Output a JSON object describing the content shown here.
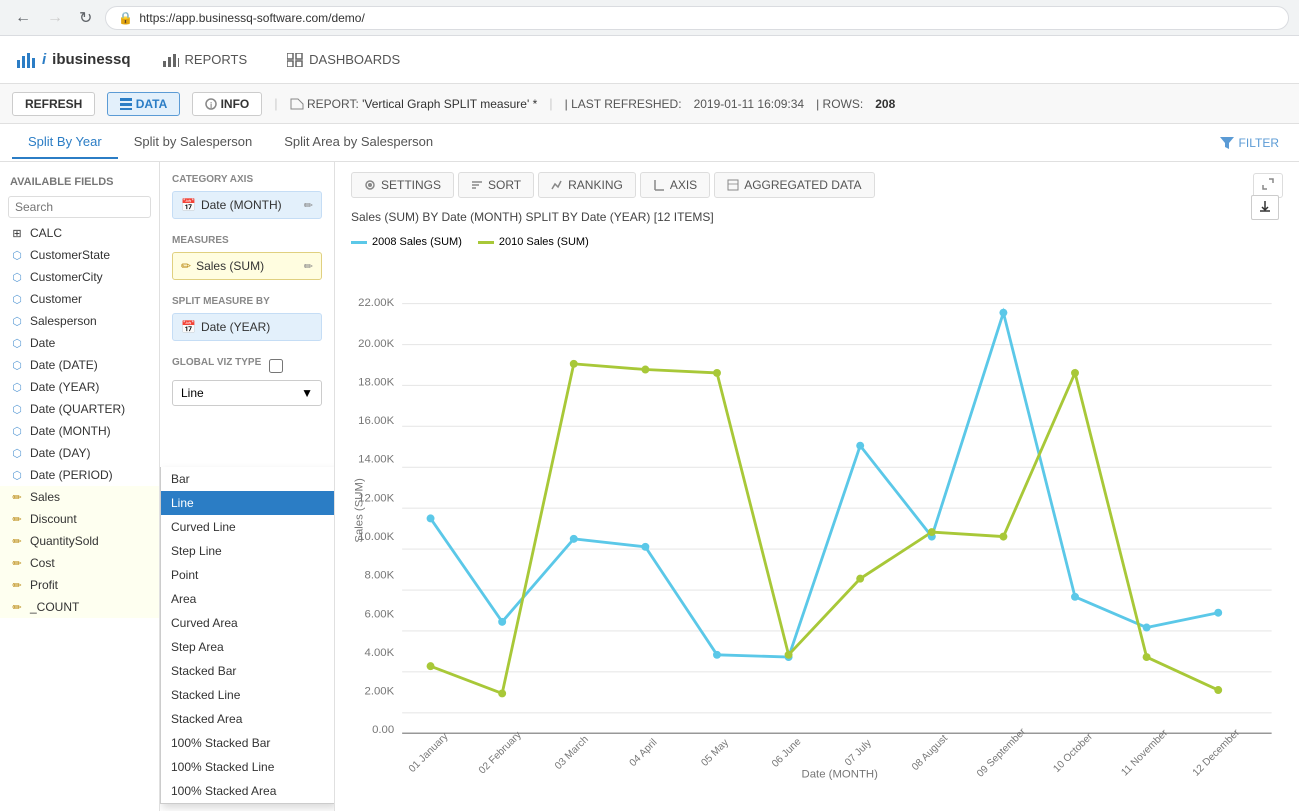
{
  "browser": {
    "url": "https://app.businessq-software.com/demo/",
    "back_disabled": false,
    "forward_disabled": true
  },
  "app": {
    "logo": "ibusinessq",
    "nav": [
      {
        "label": "REPORTS",
        "icon": "bar-chart-icon"
      },
      {
        "label": "DASHBOARDS",
        "icon": "dashboard-icon"
      }
    ]
  },
  "toolbar": {
    "refresh_label": "REFRESH",
    "data_label": "DATA",
    "info_label": "INFO",
    "report_prefix": "REPORT:",
    "report_name": "'Vertical Graph SPLIT measure' *",
    "last_refreshed_label": "| LAST REFRESHED:",
    "last_refreshed_value": "2019-01-11 16:09:34",
    "rows_label": "| ROWS:",
    "rows_value": "208"
  },
  "tabs": [
    {
      "label": "Split By Year",
      "active": true
    },
    {
      "label": "Split by Salesperson",
      "active": false
    },
    {
      "label": "Split Area by Salesperson",
      "active": false
    }
  ],
  "filter_label": "FILTER",
  "sidebar": {
    "section_title": "AVAILABLE FIELDS",
    "search_placeholder": "Search",
    "items": [
      {
        "label": "CALC",
        "type": "calc",
        "icon": "table-icon"
      },
      {
        "label": "CustomerState",
        "type": "dimension",
        "icon": "dimension-icon"
      },
      {
        "label": "CustomerCity",
        "type": "dimension",
        "icon": "dimension-icon"
      },
      {
        "label": "Customer",
        "type": "dimension",
        "icon": "dimension-icon"
      },
      {
        "label": "Salesperson",
        "type": "dimension",
        "icon": "dimension-icon"
      },
      {
        "label": "Date",
        "type": "dimension",
        "icon": "dimension-icon"
      },
      {
        "label": "Date (DATE)",
        "type": "dimension",
        "icon": "dimension-icon"
      },
      {
        "label": "Date (YEAR)",
        "type": "dimension",
        "icon": "dimension-icon"
      },
      {
        "label": "Date (QUARTER)",
        "type": "dimension",
        "icon": "dimension-icon"
      },
      {
        "label": "Date (MONTH)",
        "type": "dimension",
        "icon": "dimension-icon"
      },
      {
        "label": "Date (DAY)",
        "type": "dimension",
        "icon": "dimension-icon"
      },
      {
        "label": "Date (PERIOD)",
        "type": "dimension",
        "icon": "dimension-icon"
      },
      {
        "label": "Sales",
        "type": "measure",
        "icon": "measure-icon"
      },
      {
        "label": "Discount",
        "type": "measure",
        "icon": "measure-icon"
      },
      {
        "label": "QuantitySold",
        "type": "measure",
        "icon": "measure-icon"
      },
      {
        "label": "Cost",
        "type": "measure",
        "icon": "measure-icon"
      },
      {
        "label": "Profit",
        "type": "measure",
        "icon": "measure-icon"
      },
      {
        "label": "_COUNT",
        "type": "measure",
        "icon": "measure-icon"
      }
    ]
  },
  "config": {
    "category_axis_label": "CATEGORY AXIS",
    "category_axis_value": "Date (MONTH)",
    "measures_label": "MEASURES",
    "measures_value": "Sales (SUM)",
    "split_label": "SPLIT MEASURE BY",
    "split_value": "Date (YEAR)",
    "viz_type_label": "GLOBAL VIZ TYPE",
    "viz_type_selected": "Line",
    "viz_options": [
      "Bar",
      "Line",
      "Curved Line",
      "Step Line",
      "Point",
      "Area",
      "Curved Area",
      "Step Area",
      "Stacked Bar",
      "Stacked Line",
      "Stacked Area",
      "100% Stacked Bar",
      "100% Stacked Line",
      "100% Stacked Area"
    ]
  },
  "chart": {
    "settings_label": "SETTINGS",
    "sort_label": "SORT",
    "ranking_label": "RANKING",
    "axis_label": "AXIS",
    "aggregated_data_label": "AGGREGATED DATA",
    "title": "Sales (SUM) BY Date (MONTH) SPLIT BY Date (YEAR) [12 ITEMS]",
    "legend": [
      {
        "label": "2008 Sales (SUM)",
        "color": "#5bc8e8"
      },
      {
        "label": "2010 Sales (SUM)",
        "color": "#a8c838"
      }
    ],
    "y_axis_label": "Sales (SUM)",
    "x_axis_label": "Date (MONTH)",
    "y_ticks": [
      "22.00K",
      "20.00K",
      "18.00K",
      "16.00K",
      "14.00K",
      "12.00K",
      "10.00K",
      "8.00K",
      "6.00K",
      "4.00K",
      "2.00K",
      "0.00"
    ],
    "x_labels": [
      "01 January",
      "02 February",
      "03 March",
      "04 April",
      "05 May",
      "06 June",
      "07 July",
      "08 August",
      "09 September",
      "10 October",
      "11 November",
      "12 December"
    ]
  }
}
